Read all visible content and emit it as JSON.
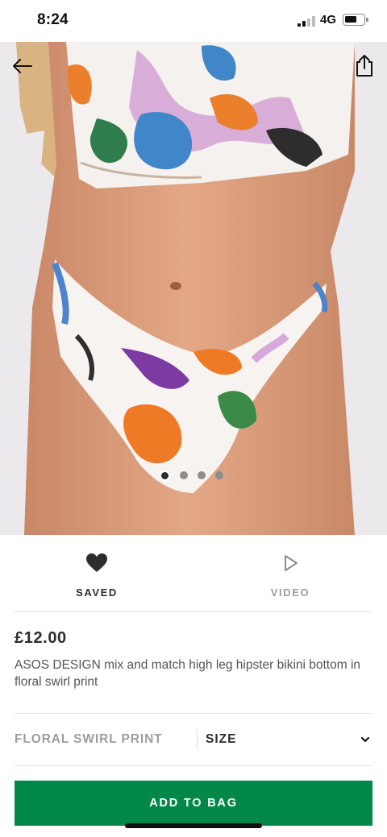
{
  "status_bar": {
    "time": "8:24",
    "network": "4G"
  },
  "gallery": {
    "image_count": 4,
    "active_index": 0,
    "image": "product-photo"
  },
  "header": {
    "back_icon": "arrow-left-icon",
    "share_icon": "share-icon"
  },
  "actions": {
    "saved": {
      "label": "SAVED",
      "icon": "heart-icon"
    },
    "video": {
      "label": "VIDEO",
      "icon": "play-icon"
    }
  },
  "product": {
    "price": "£12.00",
    "title": "ASOS DESIGN mix and match high leg hipster bikini bottom in floral swirl print",
    "colour": "FLORAL SWIRL PRINT",
    "size_label": "SIZE"
  },
  "cta": {
    "label": "ADD TO BAG",
    "color": "#018849"
  }
}
